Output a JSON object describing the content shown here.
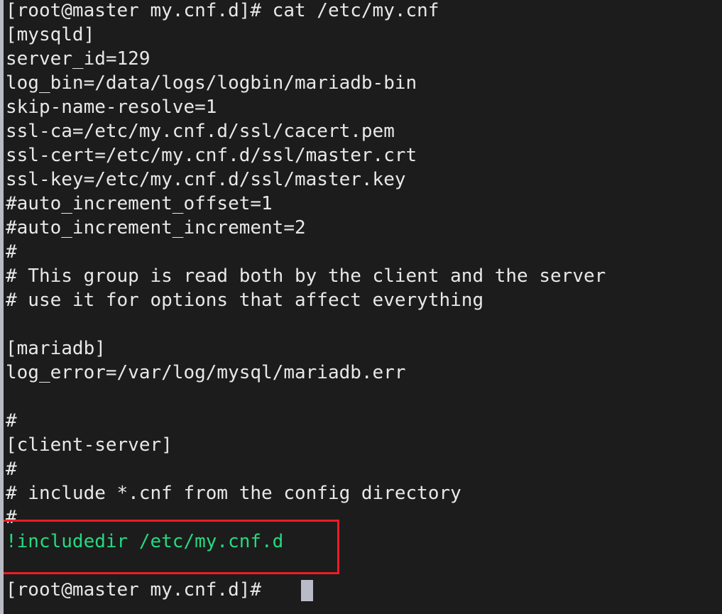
{
  "terminal": {
    "background_color": "#1c1c1c",
    "foreground_color": "#e8e8e8",
    "green_color": "#26d97f",
    "highlight_color": "#ee1c25",
    "cursor_color": "#b9bcc7",
    "command": "cat /etc/my.cnf",
    "prompt": "[root@master my.cnf.d]#",
    "lines": [
      {
        "text": "[root@master my.cnf.d]# cat /etc/my.cnf",
        "color": "default"
      },
      {
        "text": "[mysqld]",
        "color": "default"
      },
      {
        "text": "server_id=129",
        "color": "default"
      },
      {
        "text": "log_bin=/data/logs/logbin/mariadb-bin",
        "color": "default"
      },
      {
        "text": "skip-name-resolve=1",
        "color": "default"
      },
      {
        "text": "ssl-ca=/etc/my.cnf.d/ssl/cacert.pem",
        "color": "default"
      },
      {
        "text": "ssl-cert=/etc/my.cnf.d/ssl/master.crt",
        "color": "default"
      },
      {
        "text": "ssl-key=/etc/my.cnf.d/ssl/master.key",
        "color": "default"
      },
      {
        "text": "#auto_increment_offset=1",
        "color": "default"
      },
      {
        "text": "#auto_increment_increment=2",
        "color": "default"
      },
      {
        "text": "#",
        "color": "default"
      },
      {
        "text": "# This group is read both by the client and the server",
        "color": "default"
      },
      {
        "text": "# use it for options that affect everything",
        "color": "default"
      },
      {
        "text": "",
        "color": "default"
      },
      {
        "text": "[mariadb]",
        "color": "default"
      },
      {
        "text": "log_error=/var/log/mysql/mariadb.err",
        "color": "default"
      },
      {
        "text": "",
        "color": "default"
      },
      {
        "text": "#",
        "color": "default"
      },
      {
        "text": "[client-server]",
        "color": "default"
      },
      {
        "text": "#",
        "color": "default"
      },
      {
        "text": "# include *.cnf from the config directory",
        "color": "default"
      },
      {
        "text": "#",
        "color": "default"
      },
      {
        "text": "!includedir /etc/my.cnf.d",
        "color": "green"
      },
      {
        "text": "",
        "color": "default"
      },
      {
        "text": "[root@master my.cnf.d]#",
        "color": "default"
      }
    ],
    "annotation": {
      "type": "rectangle",
      "target_line_index": 22,
      "target_text": "!includedir /etc/my.cnf.d"
    }
  }
}
